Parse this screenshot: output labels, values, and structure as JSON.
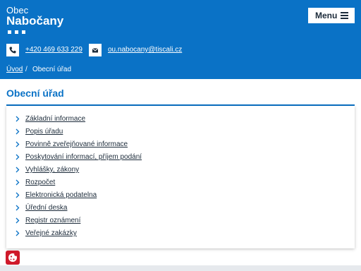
{
  "header": {
    "brand_small": "Obec",
    "brand_name": "Nabočany",
    "menu_label": "Menu",
    "phone": "+420 469 633 229",
    "email": "ou.nabocany@tiscali.cz"
  },
  "breadcrumb": {
    "home": "Úvod",
    "separator": "/",
    "current": "Obecní úřad"
  },
  "main": {
    "title": "Obecní úřad",
    "items": [
      {
        "label": "Základní informace"
      },
      {
        "label": "Popis úřadu"
      },
      {
        "label": "Povinně zveřejňované informace"
      },
      {
        "label": "Poskytování informací, příjem podání"
      },
      {
        "label": "Vyhlášky, zákony"
      },
      {
        "label": "Rozpočet"
      },
      {
        "label": "Elektronická podatelna"
      },
      {
        "label": "Úřední deska"
      },
      {
        "label": "Registr oznámení"
      },
      {
        "label": "Veřejné zakázky"
      }
    ]
  },
  "colors": {
    "brand_blue": "#0a72c6",
    "text_dark": "#1c2b3a",
    "cookie_red": "#cf1a2b"
  },
  "icons": {
    "menu": "hamburger-icon",
    "phone": "phone-icon",
    "email": "envelope-icon",
    "list_bullet": "chevron-right-icon",
    "cookie": "cookie-icon"
  }
}
